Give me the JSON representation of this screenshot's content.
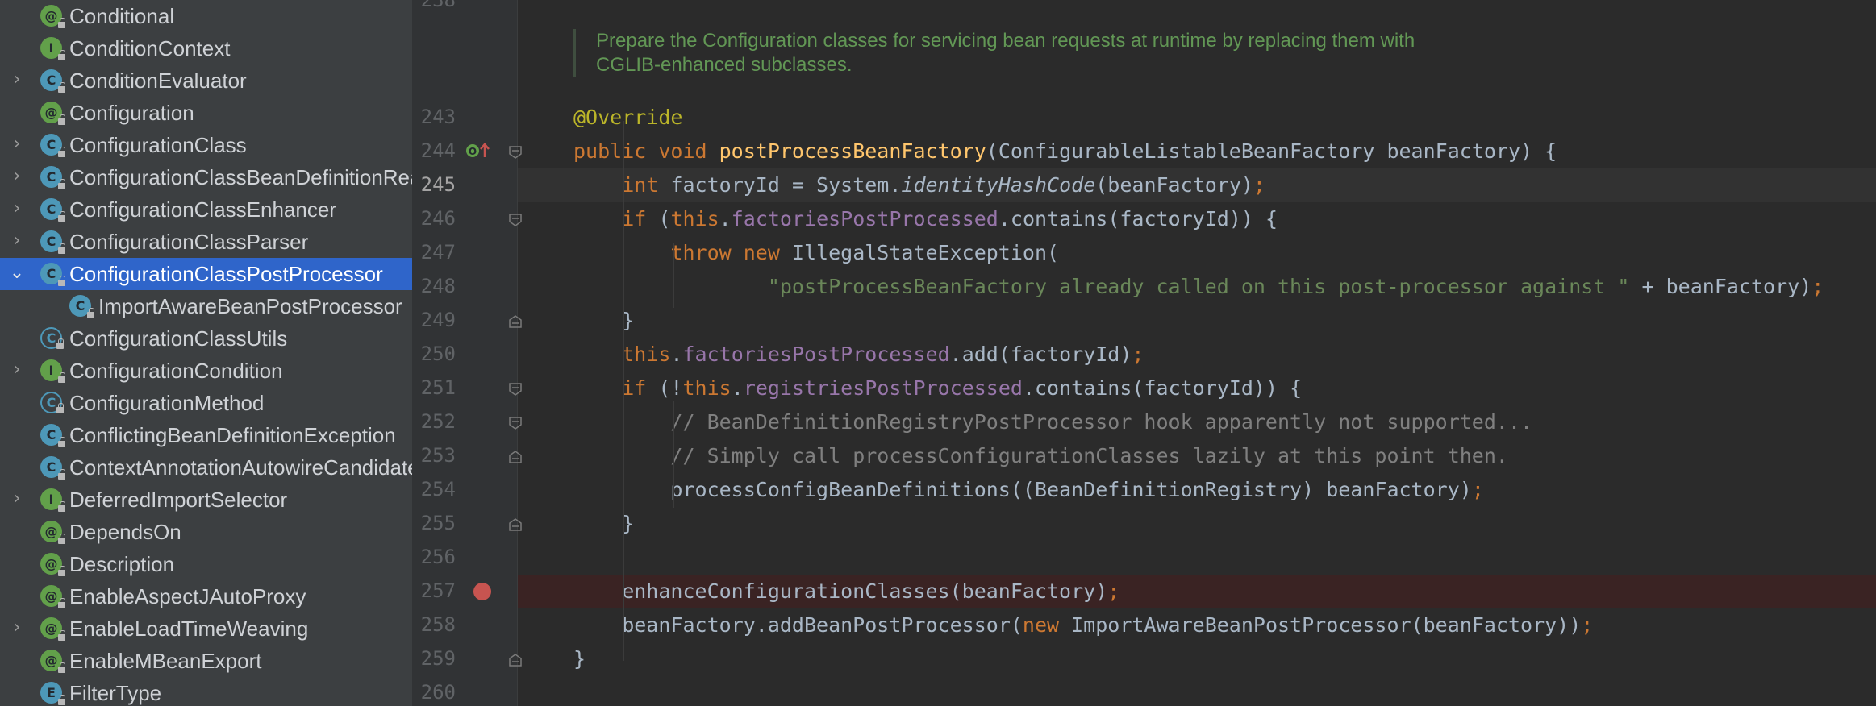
{
  "sidebar": {
    "items": [
      {
        "label": "Conditional",
        "icon": "annotation-icon",
        "kind": "a",
        "expand": ""
      },
      {
        "label": "ConditionContext",
        "icon": "interface-icon",
        "kind": "i",
        "expand": ""
      },
      {
        "label": "ConditionEvaluator",
        "icon": "class-icon",
        "kind": "c",
        "expand": "›"
      },
      {
        "label": "Configuration",
        "icon": "annotation-icon",
        "kind": "a",
        "expand": ""
      },
      {
        "label": "ConfigurationClass",
        "icon": "class-icon",
        "kind": "c",
        "expand": "›"
      },
      {
        "label": "ConfigurationClassBeanDefinitionReader",
        "icon": "class-icon",
        "kind": "c",
        "expand": "›"
      },
      {
        "label": "ConfigurationClassEnhancer",
        "icon": "class-icon",
        "kind": "c",
        "expand": "›"
      },
      {
        "label": "ConfigurationClassParser",
        "icon": "class-icon",
        "kind": "c",
        "expand": "›"
      },
      {
        "label": "ConfigurationClassPostProcessor",
        "icon": "class-icon",
        "kind": "c",
        "expand": "⌄",
        "selected": true
      },
      {
        "label": "ImportAwareBeanPostProcessor",
        "icon": "class-icon",
        "kind": "c",
        "expand": "",
        "child": true
      },
      {
        "label": "ConfigurationClassUtils",
        "icon": "abstract-class-icon",
        "kind": "abstract",
        "expand": ""
      },
      {
        "label": "ConfigurationCondition",
        "icon": "interface-icon",
        "kind": "i",
        "expand": "›"
      },
      {
        "label": "ConfigurationMethod",
        "icon": "abstract-class-icon",
        "kind": "abstract",
        "expand": ""
      },
      {
        "label": "ConflictingBeanDefinitionException",
        "icon": "class-icon",
        "kind": "c",
        "expand": ""
      },
      {
        "label": "ContextAnnotationAutowireCandidateResolver",
        "icon": "class-icon",
        "kind": "c",
        "expand": ""
      },
      {
        "label": "DeferredImportSelector",
        "icon": "interface-icon",
        "kind": "i",
        "expand": "›"
      },
      {
        "label": "DependsOn",
        "icon": "annotation-icon",
        "kind": "a",
        "expand": ""
      },
      {
        "label": "Description",
        "icon": "annotation-icon",
        "kind": "a",
        "expand": ""
      },
      {
        "label": "EnableAspectJAutoProxy",
        "icon": "annotation-icon",
        "kind": "a",
        "expand": ""
      },
      {
        "label": "EnableLoadTimeWeaving",
        "icon": "annotation-icon",
        "kind": "a",
        "expand": "›"
      },
      {
        "label": "EnableMBeanExport",
        "icon": "annotation-icon",
        "kind": "a",
        "expand": ""
      },
      {
        "label": "FilterType",
        "icon": "enum-icon",
        "kind": "e",
        "expand": ""
      }
    ],
    "icon_letters": {
      "c": "C",
      "i": "I",
      "a": "@",
      "e": "E",
      "abstract": "C"
    }
  },
  "editor": {
    "first_line_number": "238",
    "doc_comment": [
      "Prepare the Configuration classes for servicing bean requests at runtime by replacing them with",
      "CGLIB-enhanced subclasses."
    ],
    "lines": [
      {
        "num": "243",
        "tokens": [
          [
            "ann",
            "@Override"
          ]
        ]
      },
      {
        "num": "244",
        "tokens": [
          [
            "kw",
            "public void "
          ],
          [
            "fn",
            "postProcessBeanFactory"
          ],
          [
            "",
            "(ConfigurableListableBeanFactory beanFactory) {"
          ]
        ]
      },
      {
        "num": "245",
        "tokens": [
          [
            "",
            "    "
          ],
          [
            "kw",
            "int "
          ],
          [
            "",
            "factoryId = System."
          ],
          [
            "it",
            "identityHashCode"
          ],
          [
            "",
            "(beanFactory)"
          ],
          [
            "kw",
            ";"
          ]
        ]
      },
      {
        "num": "246",
        "tokens": [
          [
            "",
            "    "
          ],
          [
            "kw",
            "if "
          ],
          [
            "",
            "("
          ],
          [
            "kw",
            "this"
          ],
          [
            "",
            "."
          ],
          [
            "fld",
            "factoriesPostProcessed"
          ],
          [
            "",
            ".contains(factoryId)) {"
          ]
        ]
      },
      {
        "num": "247",
        "tokens": [
          [
            "",
            "        "
          ],
          [
            "kw",
            "throw new "
          ],
          [
            "",
            "IllegalStateException("
          ]
        ]
      },
      {
        "num": "248",
        "tokens": [
          [
            "",
            "                "
          ],
          [
            "str",
            "\"postProcessBeanFactory already called on this post-processor against \" "
          ],
          [
            "",
            "+ beanFactory)"
          ],
          [
            "kw",
            ";"
          ]
        ]
      },
      {
        "num": "249",
        "tokens": [
          [
            "",
            "    }"
          ]
        ]
      },
      {
        "num": "250",
        "tokens": [
          [
            "",
            "    "
          ],
          [
            "kw",
            "this"
          ],
          [
            "",
            "."
          ],
          [
            "fld",
            "factoriesPostProcessed"
          ],
          [
            "",
            ".add(factoryId)"
          ],
          [
            "kw",
            ";"
          ]
        ]
      },
      {
        "num": "251",
        "tokens": [
          [
            "",
            "    "
          ],
          [
            "kw",
            "if "
          ],
          [
            "",
            "(!"
          ],
          [
            "kw",
            "this"
          ],
          [
            "",
            "."
          ],
          [
            "fld",
            "registriesPostProcessed"
          ],
          [
            "",
            ".contains(factoryId)) {"
          ]
        ]
      },
      {
        "num": "252",
        "tokens": [
          [
            "",
            "        "
          ],
          [
            "cmt",
            "// BeanDefinitionRegistryPostProcessor hook apparently not supported..."
          ]
        ]
      },
      {
        "num": "253",
        "tokens": [
          [
            "",
            "        "
          ],
          [
            "cmt",
            "// Simply call processConfigurationClasses lazily at this point then."
          ]
        ]
      },
      {
        "num": "254",
        "tokens": [
          [
            "",
            "        "
          ],
          [
            "",
            "processConfigBeanDefinitions((BeanDefinitionRegistry) beanFactory)"
          ],
          [
            "kw",
            ";"
          ]
        ]
      },
      {
        "num": "255",
        "tokens": [
          [
            "",
            "    }"
          ]
        ]
      },
      {
        "num": "256",
        "tokens": []
      },
      {
        "num": "257",
        "tokens": [
          [
            "",
            "    enhanceConfigurationClasses(beanFactory)"
          ],
          [
            "kw",
            ";"
          ]
        ]
      },
      {
        "num": "258",
        "tokens": [
          [
            "",
            "    beanFactory.addBeanPostProcessor("
          ],
          [
            "kw",
            "new "
          ],
          [
            "",
            "ImportAwareBeanPostProcessor(beanFactory))"
          ],
          [
            "kw",
            ";"
          ]
        ]
      },
      {
        "num": "259",
        "tokens": [
          [
            "",
            "}"
          ]
        ]
      },
      {
        "num": "260",
        "tokens": []
      }
    ],
    "current_line": "245",
    "breakpoint_line": "257",
    "gutter_icons": {
      "override": "override-method-icon",
      "breakpoint": "breakpoint-icon",
      "fold": "fold-icon"
    },
    "colors": {
      "keyword": "#cc7832",
      "method": "#ffc66d",
      "field": "#9876aa",
      "string": "#6a8759",
      "annotation": "#bbb529",
      "comment": "#808080",
      "doc": "#629755",
      "selection": "#2f65ca",
      "breakpoint": "#c75450"
    }
  }
}
